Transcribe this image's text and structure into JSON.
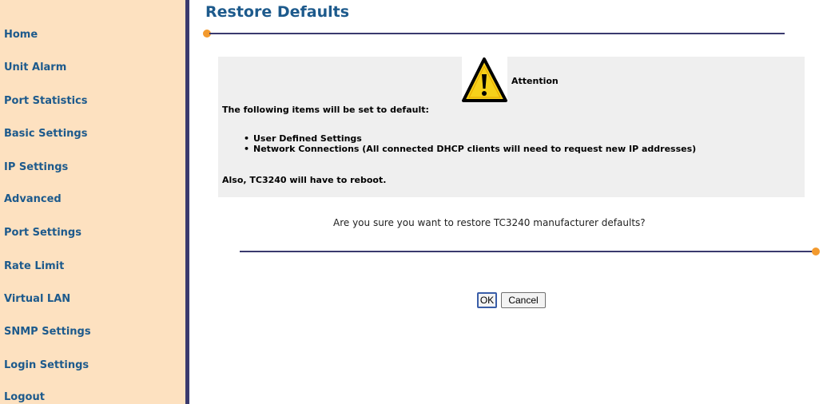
{
  "sidebar": {
    "items": [
      {
        "label": "Home"
      },
      {
        "label": "Unit Alarm"
      },
      {
        "label": "Port Statistics"
      },
      {
        "label": "Basic Settings"
      },
      {
        "label": "IP Settings"
      },
      {
        "label": "Advanced"
      },
      {
        "label": "Port Settings"
      },
      {
        "label": "Rate Limit"
      },
      {
        "label": "Virtual LAN"
      },
      {
        "label": "SNMP Settings"
      },
      {
        "label": "Login Settings"
      },
      {
        "label": "Logout"
      }
    ]
  },
  "main": {
    "title": "Restore Defaults",
    "attention": {
      "label": "Attention",
      "icon": "warning-icon",
      "intro": "The following items will be set to default:",
      "items": [
        "User Defined Settings",
        "Network Connections (All connected DHCP clients will need to request new IP addresses)"
      ],
      "reboot_note": "Also, TC3240 will have to reboot."
    },
    "question": "Are you sure you want to restore TC3240 manufacturer defaults?",
    "ok_label": "OK",
    "cancel_label": "Cancel"
  },
  "colors": {
    "sidebar_bg": "#fde1c0",
    "link": "#1d5a8c",
    "accent_orange": "#f39a2e",
    "rule": "#3a3a6e"
  }
}
